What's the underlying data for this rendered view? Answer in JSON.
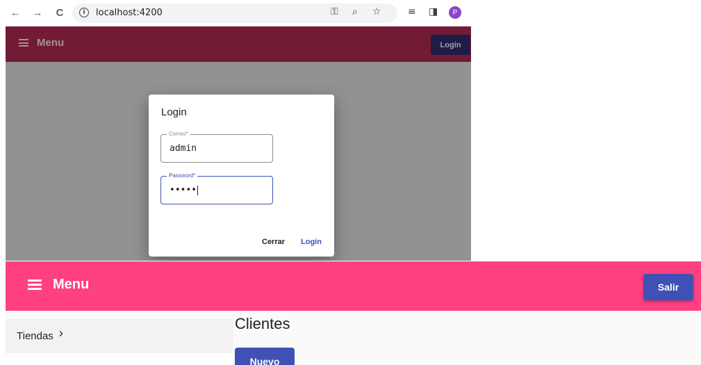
{
  "browser": {
    "back_icon": "←",
    "forward_icon": "→",
    "reload_icon": "C",
    "url": "localhost:4200",
    "profile_initial": "P"
  },
  "app_top": {
    "menu_label": "Menu",
    "login_button": "Login",
    "toolbar_color": "#a9294f"
  },
  "login_dialog": {
    "title": "Login",
    "email_label": "Correo*",
    "email_value": "admin",
    "password_label": "Password*",
    "password_value": "•••••",
    "close_button": "Cerrar",
    "login_button": "Login",
    "accent_color": "#3f51b5"
  },
  "app_bottom": {
    "menu_label": "Menu",
    "logout_button": "Salir",
    "toolbar_color": "#ff4081",
    "sidebar": {
      "items": [
        {
          "label": "Tiendas"
        }
      ]
    },
    "page_title": "Clientes",
    "new_button": "Nuevo"
  }
}
